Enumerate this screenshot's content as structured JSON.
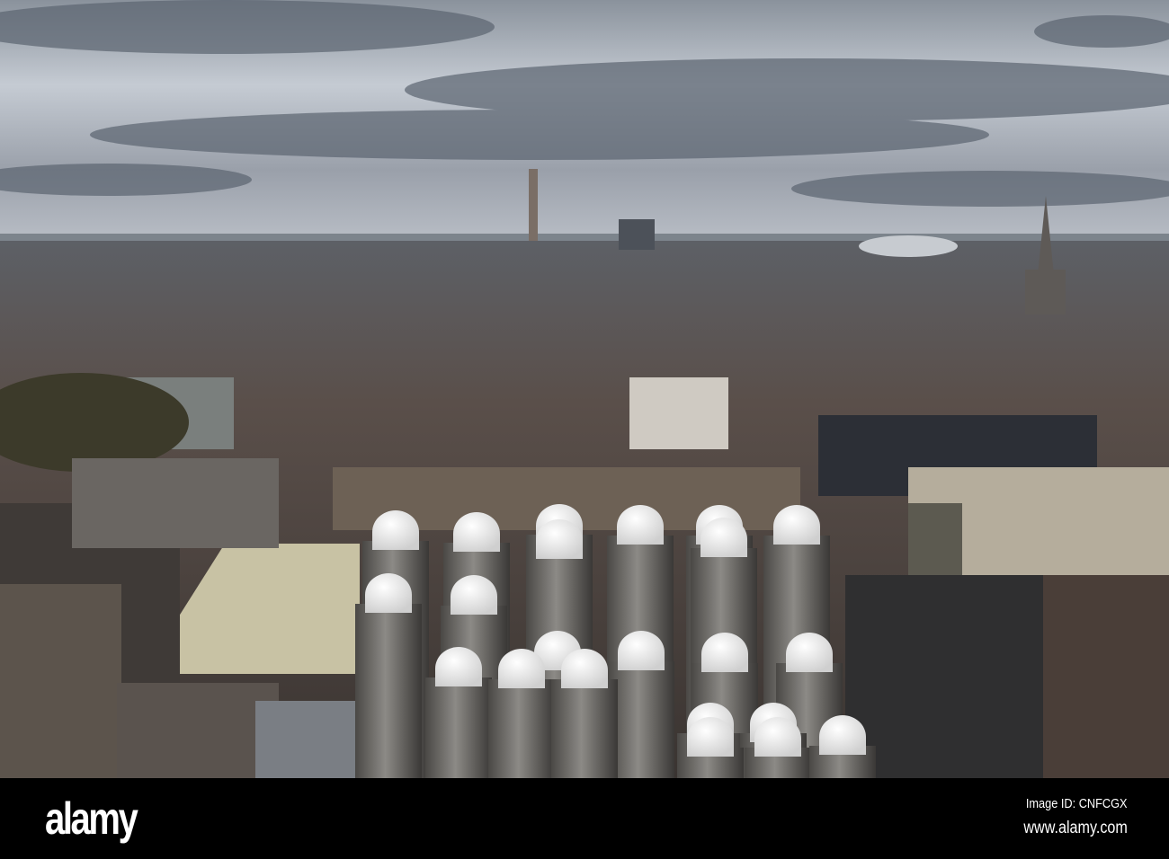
{
  "photo": {
    "description_hidden": false
  },
  "watermark": {
    "logo_text": "a"
  },
  "footer": {
    "brand": "alamy",
    "image_id": "Image ID: CNFCGX",
    "url": "www.alamy.com"
  }
}
